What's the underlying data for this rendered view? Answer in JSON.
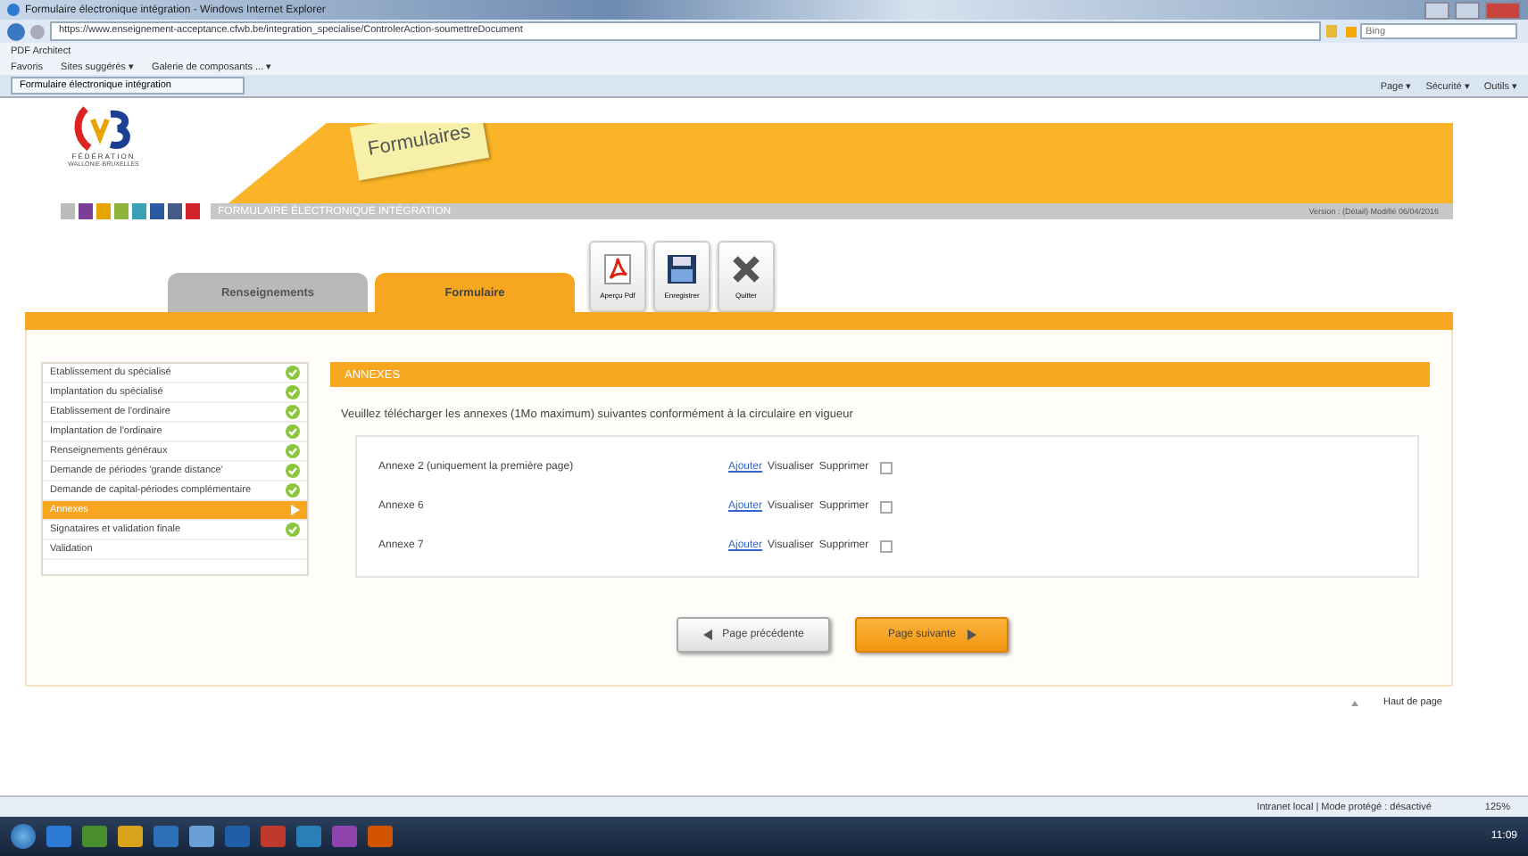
{
  "window": {
    "title": "Formulaire électronique intégration - Windows Internet Explorer"
  },
  "address_bar": {
    "url": "https://www.enseignement-acceptance.cfwb.be/integration_specialise/ControlerAction-soumettreDocument",
    "search_placeholder": "Bing"
  },
  "command_bar": {
    "addon": "PDF Architect",
    "favorites": "Favoris",
    "links": [
      "Sites suggérés ▾",
      "Galerie de composants ... ▾"
    ],
    "tab": "Formulaire électronique intégration",
    "menus": [
      "Page ▾",
      "Sécurité ▾",
      "Outils ▾"
    ]
  },
  "header": {
    "logo_lines": [
      "FÉDÉRATION",
      "WALLONIE-BRUXELLES"
    ],
    "sticker": "Formulaires",
    "subtitle": "FORMULAIRE ÉLECTRONIQUE INTÉGRATION",
    "version": "Version : (Détail) Modifié 06/04/2016"
  },
  "tabs": [
    {
      "label": "Renseignements",
      "selected": false
    },
    {
      "label": "Formulaire",
      "selected": true
    }
  ],
  "toolbar": [
    {
      "kind": "pdf",
      "label": "Aperçu Pdf"
    },
    {
      "kind": "save",
      "label": "Enregistrer"
    },
    {
      "kind": "quit",
      "label": "Quitter"
    }
  ],
  "sidebar": {
    "items": [
      {
        "label": "Etablissement du spécialisé",
        "done": true,
        "selected": false
      },
      {
        "label": "Implantation du spécialisé",
        "done": true,
        "selected": false
      },
      {
        "label": "Etablissement de l'ordinaire",
        "done": true,
        "selected": false
      },
      {
        "label": "Implantation de l'ordinaire",
        "done": true,
        "selected": false
      },
      {
        "label": "Renseignements généraux",
        "done": true,
        "selected": false
      },
      {
        "label": "Demande de périodes 'grande distance'",
        "done": true,
        "selected": false
      },
      {
        "label": "Demande de capital-périodes complémentaire",
        "done": true,
        "selected": false
      },
      {
        "label": "Annexes",
        "done": false,
        "selected": true
      },
      {
        "label": "Signataires et validation finale",
        "done": true,
        "selected": false
      },
      {
        "label": "Validation",
        "done": false,
        "selected": false
      }
    ]
  },
  "section": {
    "title": "ANNEXES",
    "instruction": "Veuillez télécharger les annexes (1Mo maximum) suivantes conformément à la circulaire en vigueur",
    "rows": [
      {
        "label": "Annexe 2 (uniquement la première page)",
        "actions": [
          "Ajouter",
          "Visualiser",
          "Supprimer"
        ],
        "checked": false
      },
      {
        "label": "Annexe 6",
        "actions": [
          "Ajouter",
          "Visualiser",
          "Supprimer"
        ],
        "checked": false
      },
      {
        "label": "Annexe 7",
        "actions": [
          "Ajouter",
          "Visualiser",
          "Supprimer"
        ],
        "checked": false
      }
    ]
  },
  "nav_buttons": [
    {
      "kind": "prev",
      "label": "Page précédente"
    },
    {
      "kind": "next",
      "label": "Page suivante"
    }
  ],
  "footer_link": "Haut de page",
  "status_bar": {
    "zone": "Intranet local | Mode protégé : désactivé",
    "zoom": "125%"
  },
  "taskbar": {
    "time": "11:09"
  }
}
